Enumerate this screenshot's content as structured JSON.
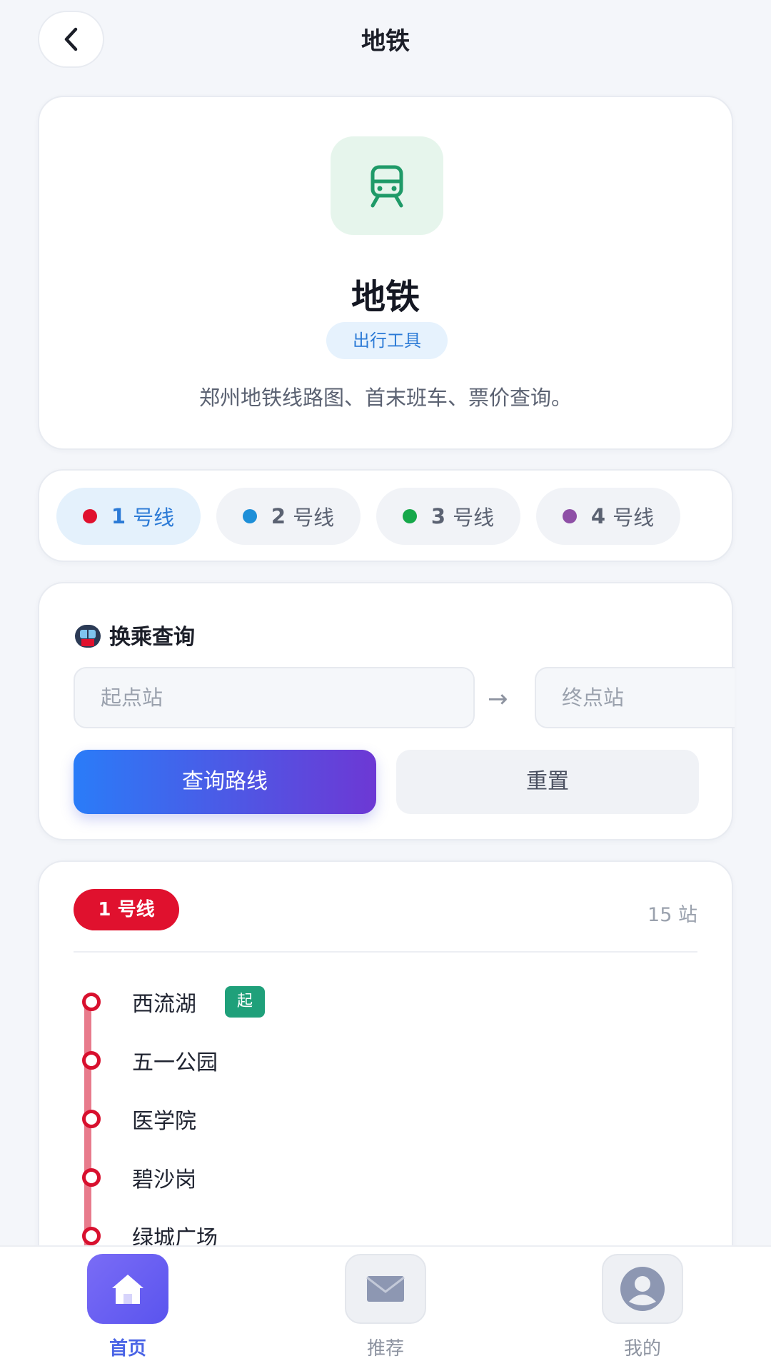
{
  "header": {
    "title": "地铁",
    "back_icon": "chevron-left-icon"
  },
  "intro": {
    "icon": "train-icon",
    "name": "地铁",
    "tag": "出行工具",
    "description": "郑州地铁线路图、首末班车、票价查询。"
  },
  "lines": [
    {
      "num": "1",
      "label": "号线",
      "color": "#e0112e",
      "active": true
    },
    {
      "num": "2",
      "label": "号线",
      "color": "#1e8fd8",
      "active": false
    },
    {
      "num": "3",
      "label": "号线",
      "color": "#16a84a",
      "active": false
    },
    {
      "num": "4",
      "label": "号线",
      "color": "#8e4fa6",
      "active": false
    }
  ],
  "transfer": {
    "icon": "metro-icon",
    "title": "换乘查询",
    "start_placeholder": "起点站",
    "arrow": "→",
    "end_placeholder": "终点站",
    "query_button": "查询路线",
    "reset_button": "重置"
  },
  "line_detail": {
    "badge": "1 号线",
    "count": "15 站",
    "stations": [
      {
        "name": "西流湖",
        "badge": "起"
      },
      {
        "name": "五一公园"
      },
      {
        "name": "医学院"
      },
      {
        "name": "碧沙岗"
      },
      {
        "name": "绿城广场"
      }
    ]
  },
  "nav": [
    {
      "label": "首页",
      "icon": "home-icon",
      "active": true
    },
    {
      "label": "推荐",
      "icon": "mail-icon",
      "active": false
    },
    {
      "label": "我的",
      "icon": "user-icon",
      "active": false
    }
  ],
  "colors": {
    "accent": "#4a64e6",
    "line1": "#e0112e",
    "start_badge": "#1fa07a"
  }
}
